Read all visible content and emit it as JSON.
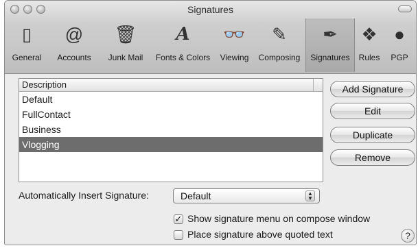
{
  "window": {
    "title": "Signatures"
  },
  "toolbar": {
    "items": [
      {
        "label": "General",
        "icon": "general-switch-icon",
        "glyph": "▯"
      },
      {
        "label": "Accounts",
        "icon": "at-sign-icon",
        "glyph": "@"
      },
      {
        "label": "Junk Mail",
        "icon": "trash-can-icon",
        "glyph": "🗑"
      },
      {
        "label": "Fonts & Colors",
        "icon": "font-letter-icon",
        "glyph": "A"
      },
      {
        "label": "Viewing",
        "icon": "glasses-icon",
        "glyph": "👓"
      },
      {
        "label": "Composing",
        "icon": "pencil-paper-icon",
        "glyph": "✎"
      },
      {
        "label": "Signatures",
        "icon": "pen-signature-icon",
        "glyph": "✒"
      },
      {
        "label": "Rules",
        "icon": "rules-icon",
        "glyph": "❖"
      },
      {
        "label": "PGP",
        "icon": "pgp-icon",
        "glyph": "●"
      }
    ],
    "selected": "Signatures"
  },
  "signatures_list": {
    "header": "Description",
    "rows": [
      "Default",
      "FullContact",
      "Business",
      "Vlogging"
    ],
    "selected": "Vlogging"
  },
  "buttons": {
    "add": "Add Signature",
    "edit": "Edit",
    "duplicate": "Duplicate",
    "remove": "Remove"
  },
  "auto_insert": {
    "label": "Automatically Insert Signature:",
    "value": "Default"
  },
  "options": {
    "show_menu": {
      "label": "Show signature menu on compose window",
      "checked": true
    },
    "place_above": {
      "label": "Place signature above quoted text",
      "checked": false
    }
  },
  "help": {
    "glyph": "?"
  }
}
